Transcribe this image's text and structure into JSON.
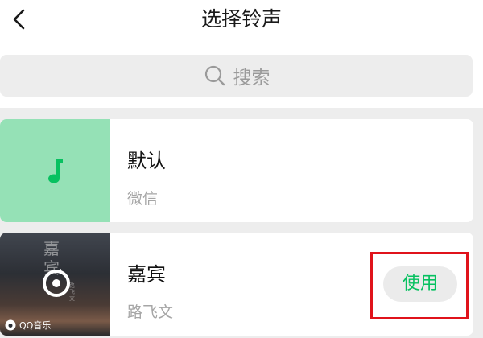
{
  "header": {
    "title": "选择铃声",
    "back_icon": "chevron-left-icon"
  },
  "search": {
    "placeholder": "搜索",
    "icon": "search-icon"
  },
  "ringtones": [
    {
      "title": "默认",
      "artist": "微信",
      "cover_icon": "music-note-icon",
      "cover_color": "#95e1b6"
    },
    {
      "title": "嘉宾",
      "artist": "路飞文",
      "cover_text": "嘉宾",
      "cover_subtext": "路飞文",
      "cover_icon": "album-disc-icon",
      "source_label": "QQ音乐",
      "source_icon": "qq-music-icon",
      "action_label": "使用"
    }
  ],
  "colors": {
    "accent": "#07c160",
    "highlight": "#e0131b",
    "background": "#ededed"
  }
}
